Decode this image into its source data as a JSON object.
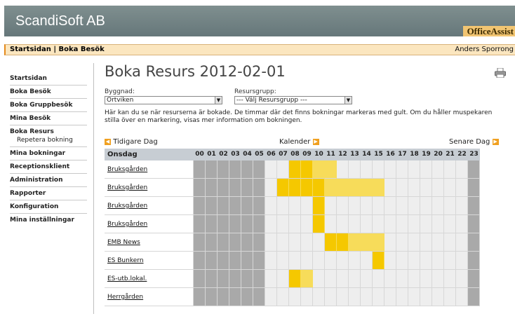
{
  "header": {
    "logo": "ScandiSoft AB",
    "brand": "OfficeAssist"
  },
  "breadcrumb": {
    "home": "Startsidan",
    "separator": " | ",
    "current": "Boka Besök",
    "user": "Anders Sporrong"
  },
  "sidebar": {
    "items": [
      {
        "label": "Startsidan"
      },
      {
        "label": "Boka Besök"
      },
      {
        "label": "Boka Gruppbesök"
      },
      {
        "label": "Mina Besök"
      },
      {
        "label": "Boka Resurs",
        "sub": "Repetera bokning"
      },
      {
        "label": "Mina bokningar"
      },
      {
        "label": "Receptionsklient"
      },
      {
        "label": "Administration"
      },
      {
        "label": "Rapporter"
      },
      {
        "label": "Konfiguration"
      },
      {
        "label": "Mina inställningar"
      }
    ]
  },
  "page": {
    "title": "Boka Resurs 2012-02-01"
  },
  "filters": {
    "building_label": "Byggnad:",
    "building_value": "Ortviken",
    "group_label": "Resursgrupp:",
    "group_value": "--- Välj Resursgrupp ---"
  },
  "info_text": "Här kan du se när resurserna är bokade. De timmar där det finns bokningar markeras med gult. Om du håller muspekaren stilla över en markering, visas mer information om bokningen.",
  "nav": {
    "prev": "Tidigare Dag",
    "calendar": "Kalender",
    "next": "Senare Dag"
  },
  "schedule": {
    "day": "Onsdag",
    "hours": [
      "00",
      "01",
      "02",
      "03",
      "04",
      "05",
      "06",
      "07",
      "08",
      "09",
      "10",
      "11",
      "12",
      "13",
      "14",
      "15",
      "16",
      "17",
      "18",
      "19",
      "20",
      "21",
      "22",
      "23"
    ],
    "colors": {
      "closed": "#a9a9a9",
      "open": "#eeeeee",
      "booked_strong": "#f5c800",
      "booked_light": "#f7dc5a"
    },
    "resources": [
      {
        "name": "Bruksgården",
        "booked": [
          8,
          9,
          10,
          11
        ]
      },
      {
        "name": "Bruksgården",
        "booked": [
          7,
          8,
          9,
          10,
          11,
          12,
          13,
          14,
          15
        ]
      },
      {
        "name": "Bruksgården",
        "booked": [
          10
        ]
      },
      {
        "name": "Bruksgården",
        "booked": [
          10
        ]
      },
      {
        "name": "EMB News",
        "booked": [
          11,
          12,
          13,
          14,
          15
        ]
      },
      {
        "name": "ES Bunkern",
        "booked": [
          15
        ]
      },
      {
        "name": "ES-utb.lokal.",
        "booked": [
          8,
          9
        ]
      },
      {
        "name": "Herrgården",
        "booked": []
      }
    ]
  }
}
